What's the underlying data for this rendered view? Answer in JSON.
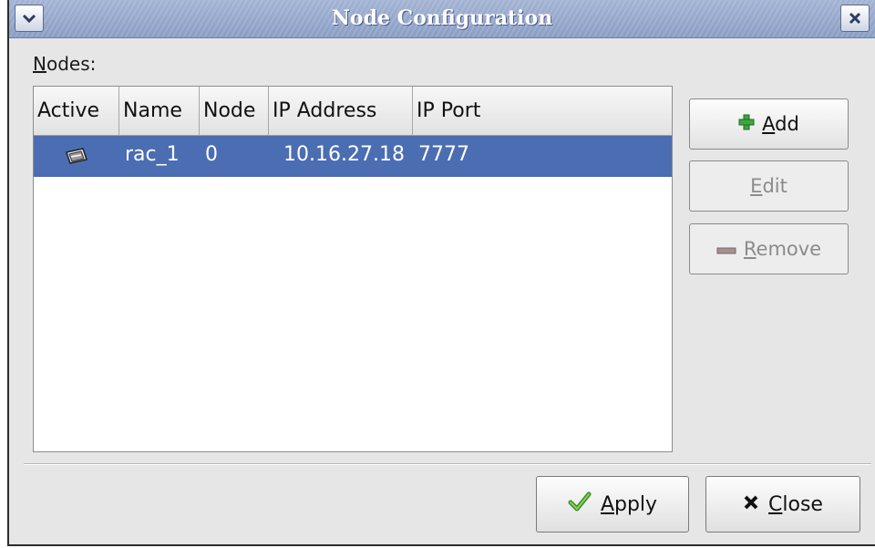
{
  "window": {
    "title": "Node Configuration"
  },
  "nodes_label": {
    "accel": "N",
    "rest": "odes:"
  },
  "list": {
    "columns": [
      "Active",
      "Name",
      "Node",
      "IP Address",
      "IP Port"
    ],
    "rows": [
      {
        "active_icon": "active-node-icon",
        "name": "rac_1",
        "node": "0",
        "ip_address": "10.16.27.18",
        "ip_port": "7777",
        "selected": true
      }
    ],
    "selection_color": "#4b6db2"
  },
  "buttons": {
    "add": {
      "accel": "A",
      "rest": "dd",
      "icon": "plus-icon"
    },
    "edit": {
      "accel": "E",
      "rest": "dit",
      "disabled": true
    },
    "remove": {
      "accel": "R",
      "rest": "emove",
      "icon": "minus-icon",
      "disabled": true
    },
    "apply": {
      "accel": "A",
      "rest": "pply",
      "icon": "checkmark-icon"
    },
    "close": {
      "accel": "C",
      "rest": "lose",
      "icon": "x-icon"
    }
  }
}
